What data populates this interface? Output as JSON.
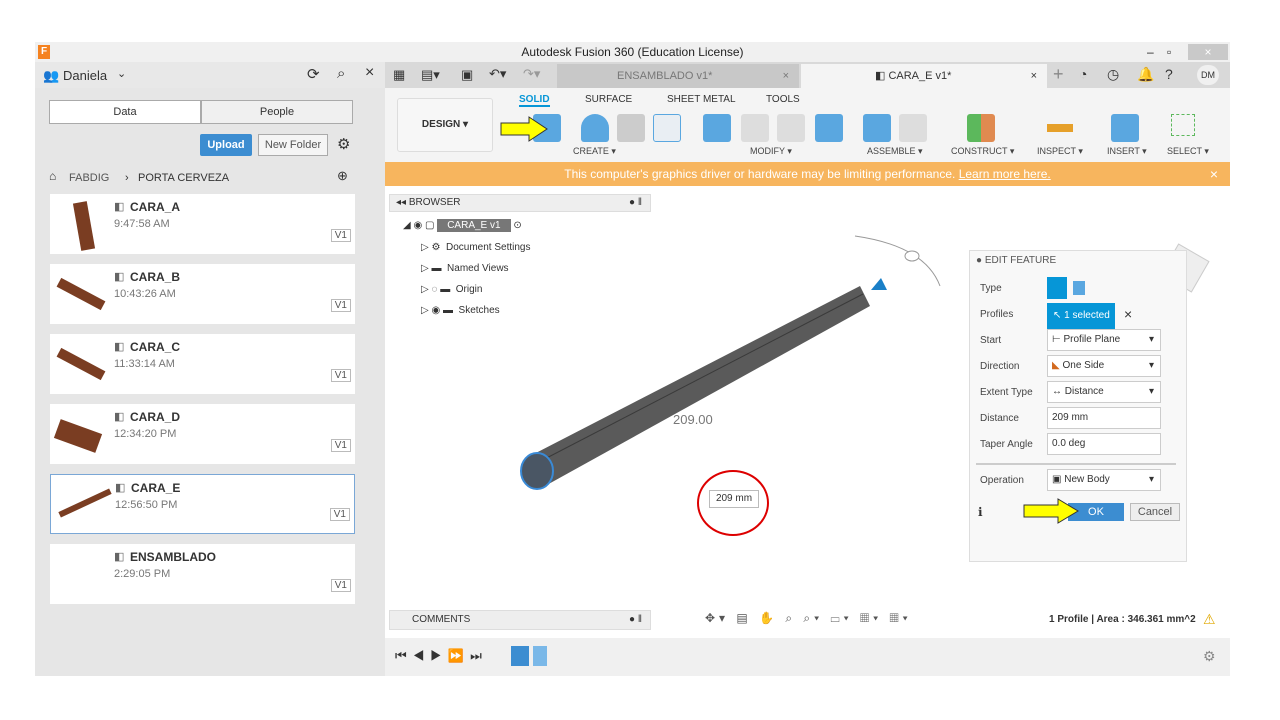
{
  "window": {
    "title": "Autodesk Fusion 360 (Education License)",
    "minimize": "–",
    "close": "×"
  },
  "left": {
    "user": "Daniela",
    "tabs": [
      "Data",
      "People"
    ],
    "upload": "Upload",
    "new_folder": "New Folder",
    "breadcrumb": [
      "FABDIG",
      "PORTA CERVEZA"
    ],
    "files": [
      {
        "name": "CARA_A",
        "time": "9:47:58 AM",
        "version": "V1"
      },
      {
        "name": "CARA_B",
        "time": "10:43:26 AM",
        "version": "V1"
      },
      {
        "name": "CARA_C",
        "time": "11:33:14 AM",
        "version": "V1"
      },
      {
        "name": "CARA_D",
        "time": "12:34:20 PM",
        "version": "V1"
      },
      {
        "name": "CARA_E",
        "time": "12:56:50 PM",
        "version": "V1"
      },
      {
        "name": "ENSAMBLADO",
        "time": "2:29:05 PM",
        "version": "V1"
      }
    ]
  },
  "doc_tabs": [
    {
      "label": "ENSAMBLADO v1*",
      "active": false
    },
    {
      "label": "CARA_E v1*",
      "active": true
    }
  ],
  "user_initials": "DM",
  "ribbon": {
    "workspace": "DESIGN ▾",
    "tabs": [
      "SOLID",
      "SURFACE",
      "SHEET METAL",
      "TOOLS"
    ],
    "groups": [
      "CREATE ▾",
      "MODIFY ▾",
      "ASSEMBLE ▾",
      "CONSTRUCT ▾",
      "INSPECT ▾",
      "INSERT ▾",
      "SELECT ▾"
    ]
  },
  "banner": {
    "text": "This computer's graphics driver or hardware may be limiting performance.",
    "link": "Learn more here.",
    "close": "×",
    "color": "#f7b55e"
  },
  "browser": {
    "title": "BROWSER",
    "root": "CARA_E v1",
    "items": [
      "Document Settings",
      "Named Views",
      "Origin",
      "Sketches"
    ]
  },
  "viewport": {
    "dimension_label": "209.00",
    "input_value": "209 mm"
  },
  "edit_feature": {
    "title": "EDIT FEATURE",
    "rows": [
      {
        "label": "Type"
      },
      {
        "label": "Profiles",
        "value": "1 selected"
      },
      {
        "label": "Start",
        "value": "Profile Plane"
      },
      {
        "label": "Direction",
        "value": "One Side"
      },
      {
        "label": "Extent Type",
        "value": "Distance"
      },
      {
        "label": "Distance",
        "value": "209 mm"
      },
      {
        "label": "Taper Angle",
        "value": "0.0 deg"
      },
      {
        "label": "Operation",
        "value": "New Body"
      }
    ],
    "ok": "OK",
    "cancel": "Cancel"
  },
  "comments": "COMMENTS",
  "status": "1 Profile | Area : 346.361 mm^2",
  "accent": "#0696d7"
}
